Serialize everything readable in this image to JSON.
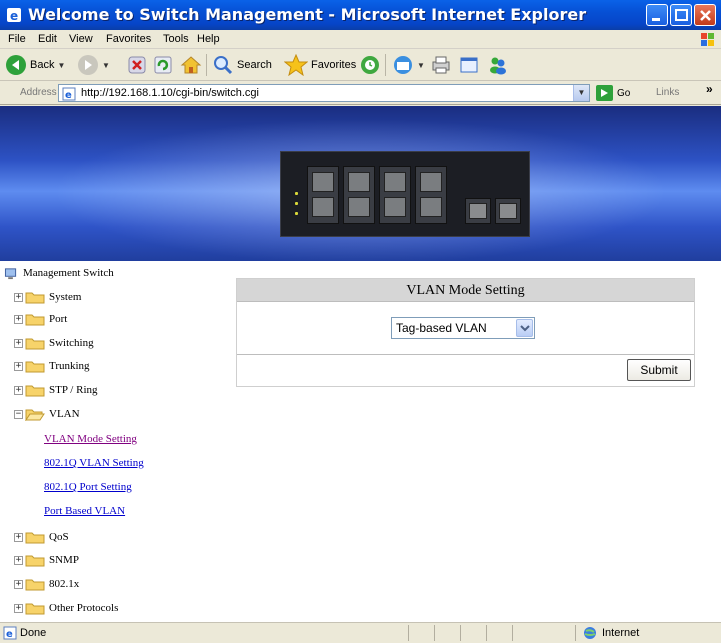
{
  "window": {
    "title": "Welcome to Switch Management - Microsoft Internet Explorer"
  },
  "menu": {
    "items": [
      "File",
      "Edit",
      "View",
      "Favorites",
      "Tools",
      "Help"
    ]
  },
  "toolbar": {
    "back_label": "Back",
    "search_label": "Search",
    "favorites_label": "Favorites"
  },
  "address": {
    "label": "Address",
    "url": "http://192.168.1.10/cgi-bin/switch.cgi",
    "go_label": "Go",
    "links_label": "Links",
    "more": "»"
  },
  "sidebar": {
    "root": "Management Switch",
    "items": [
      {
        "label": "System"
      },
      {
        "label": "Port"
      },
      {
        "label": "Switching"
      },
      {
        "label": "Trunking"
      },
      {
        "label": "STP / Ring"
      },
      {
        "label": "VLAN"
      },
      {
        "label": "QoS"
      },
      {
        "label": "SNMP"
      },
      {
        "label": "802.1x"
      },
      {
        "label": "Other Protocols"
      }
    ],
    "vlan_children": [
      {
        "label": "VLAN Mode Setting"
      },
      {
        "label": "802.1Q VLAN Setting"
      },
      {
        "label": "802.1Q Port Setting"
      },
      {
        "label": "Port Based VLAN"
      }
    ]
  },
  "form": {
    "heading": "VLAN Mode Setting",
    "mode_value": "Tag-based VLAN",
    "submit_label": "Submit"
  },
  "status": {
    "text": "Done",
    "zone": "Internet"
  }
}
